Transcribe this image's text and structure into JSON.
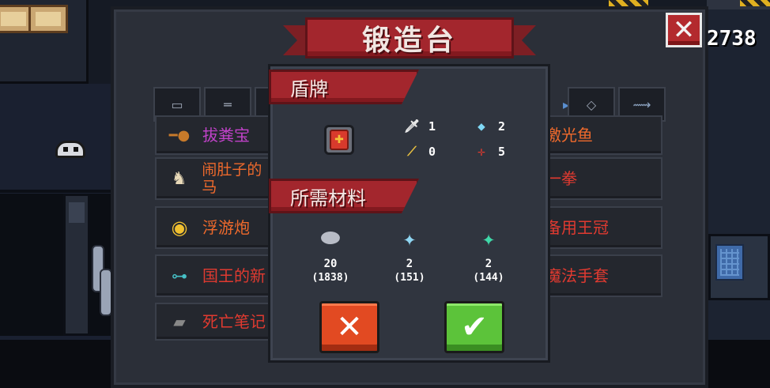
{
  "window": {
    "title": "锻造台",
    "gem_count": "2738"
  },
  "tabs": [
    {
      "icon": "pistol-icon"
    },
    {
      "icon": "rifle-icon"
    },
    {
      "icon": "blade-icon"
    },
    {
      "icon": "bow-icon"
    },
    {
      "icon": "staff-icon"
    },
    {
      "icon": "hammer-icon"
    },
    {
      "icon": "gun-icon"
    },
    {
      "icon": "diamond-icon"
    },
    {
      "icon": "fish-icon"
    }
  ],
  "items_left": [
    {
      "name": "拔粪宝",
      "color": "#c142c9"
    },
    {
      "name": "闹肚子的马",
      "color": "#ef6a2c"
    },
    {
      "name": "浮游炮",
      "color": "#ef6a2c"
    },
    {
      "name": "国王的新",
      "color": "#e03a30"
    },
    {
      "name": "死亡笔记",
      "color": "#e03a30"
    }
  ],
  "items_right": [
    {
      "name": "激光鱼",
      "color": "#ef6a2c"
    },
    {
      "name": "一拳",
      "color": "#e03a30"
    },
    {
      "name": "备用王冠",
      "color": "#e03a30"
    },
    {
      "name": "魔法手套",
      "color": "#e03a30"
    }
  ],
  "detail": {
    "item_name": "盾牌",
    "item_icon": "shield-icon",
    "stats": {
      "damage": "1",
      "energy": "2",
      "crit": "0",
      "accuracy": "5"
    },
    "materials_title": "所需材料",
    "materials": [
      {
        "icon": "ore-icon",
        "required": "20",
        "owned": "(1838)"
      },
      {
        "icon": "blue-crystal-icon",
        "required": "2",
        "owned": "(151)"
      },
      {
        "icon": "green-crystal-icon",
        "required": "2",
        "owned": "(144)"
      }
    ],
    "cancel_label": "✕",
    "confirm_label": "✔"
  }
}
